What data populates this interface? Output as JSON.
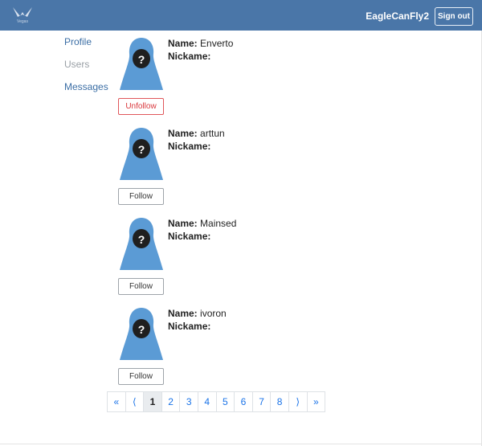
{
  "header": {
    "logo_text": "Vegas",
    "username": "EagleCanFly2",
    "signout_label": "Sign out"
  },
  "nav": [
    {
      "label": "Profile",
      "active": true
    },
    {
      "label": "Users",
      "active": false
    },
    {
      "label": "Messages",
      "active": true
    }
  ],
  "labels": {
    "name": "Name:",
    "nickname": "Nickame:"
  },
  "users": [
    {
      "name": "Enverto",
      "nickname": "",
      "button": "Unfollow"
    },
    {
      "name": "arttun",
      "nickname": "",
      "button": "Follow"
    },
    {
      "name": "Mainsed",
      "nickname": "",
      "button": "Follow"
    },
    {
      "name": "ivoron",
      "nickname": "",
      "button": "Follow"
    }
  ],
  "pagination": {
    "items": [
      "«",
      "⟨",
      "1",
      "2",
      "3",
      "4",
      "5",
      "6",
      "7",
      "8",
      "⟩",
      "»"
    ],
    "current": "1"
  },
  "colors": {
    "header_bg": "#4a76a8",
    "avatar_body": "#5b9bd5",
    "link": "#3b6ea5",
    "unfollow": "#d9363b"
  }
}
